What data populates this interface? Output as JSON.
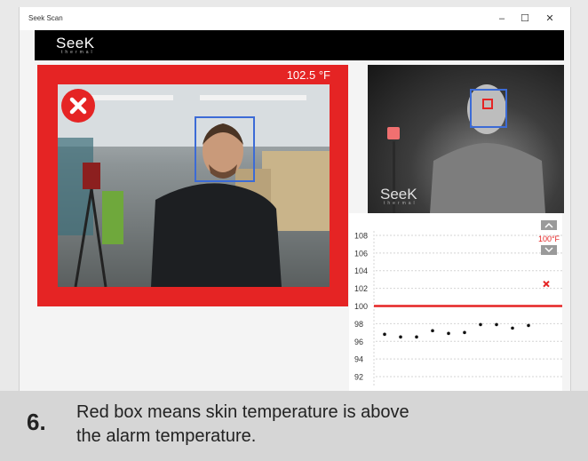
{
  "window": {
    "title": "Seek Scan",
    "minimize": "–",
    "maximize": "☐",
    "close": "✕"
  },
  "brand": {
    "logo": "SeeK",
    "sub": "thermal"
  },
  "camera": {
    "temperature": "102.5 °F",
    "status_icon": "x-circle-icon"
  },
  "thermal_view": {
    "logo": "SeeK",
    "sub": "thermal"
  },
  "alarm": {
    "label": "100°F",
    "up_icon": "chevron-up-icon",
    "down_icon": "chevron-down-icon"
  },
  "colors": {
    "alarm_red": "#e52424",
    "face_box": "#3c6bd6"
  },
  "chart_data": {
    "type": "scatter",
    "yticks": [
      "108",
      "106",
      "104",
      "102",
      "100",
      "98",
      "96",
      "94",
      "92"
    ],
    "ylim": [
      91,
      108.5
    ],
    "threshold": 100,
    "series": [
      {
        "values": [
          96.8,
          96.5,
          96.5,
          97.2,
          96.9,
          97.0,
          97.9,
          97.9,
          97.5,
          97.8
        ]
      },
      {
        "values": [
          102.5
        ],
        "marker": "x"
      }
    ]
  },
  "caption": {
    "step": "6.",
    "line1": "Red box means skin temperature is above",
    "line2": "the alarm temperature."
  }
}
